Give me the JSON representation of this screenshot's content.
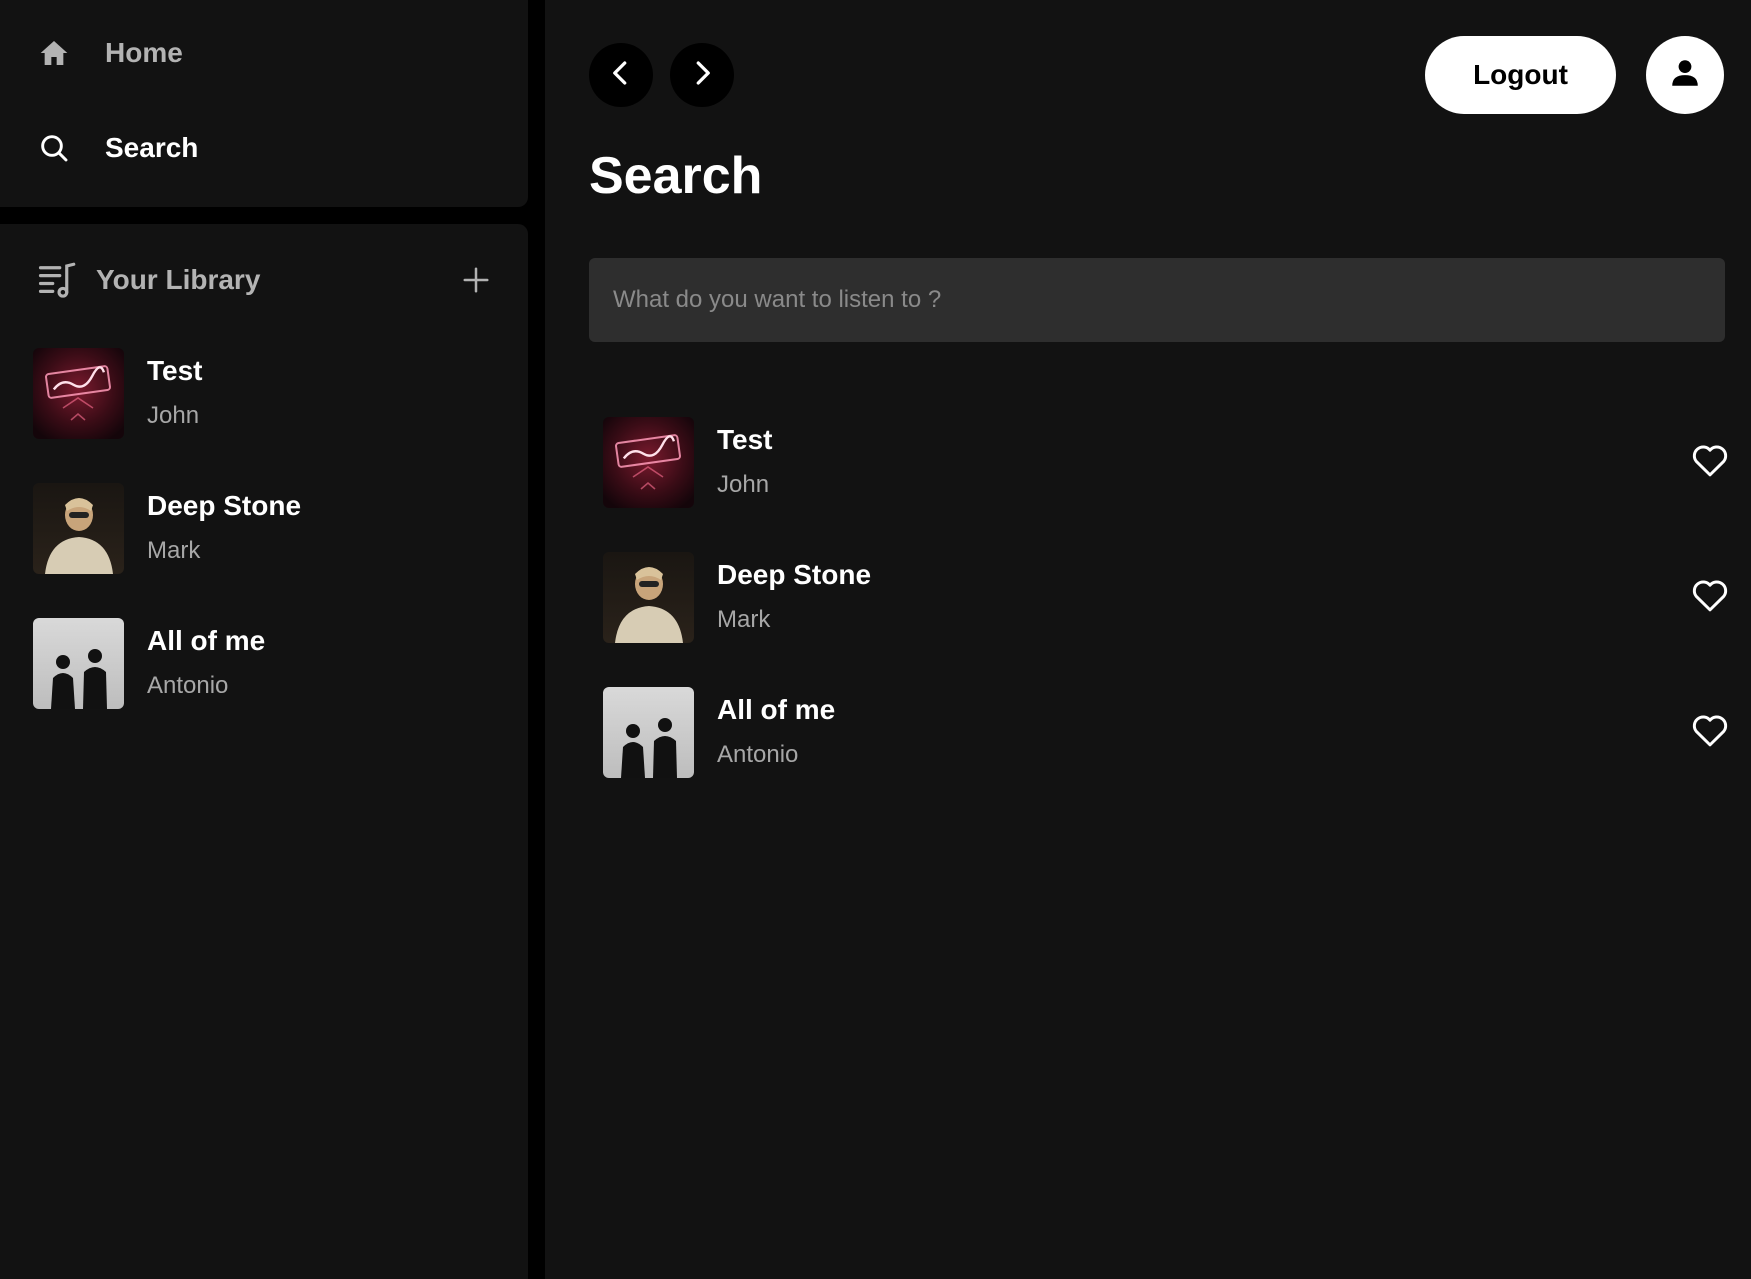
{
  "sidebar": {
    "nav": [
      {
        "label": "Home",
        "icon": "home-icon"
      },
      {
        "label": "Search",
        "icon": "search-icon"
      }
    ],
    "library": {
      "title": "Your Library",
      "icon": "library-icon",
      "add_icon": "plus-icon",
      "items": [
        {
          "title": "Test",
          "artist": "John",
          "cover": "neon-sign-cover"
        },
        {
          "title": "Deep Stone",
          "artist": "Mark",
          "cover": "portrait-cover"
        },
        {
          "title": "All of me",
          "artist": "Antonio",
          "cover": "duo-cover"
        }
      ]
    }
  },
  "header": {
    "back_icon": "chevron-left-icon",
    "forward_icon": "chevron-right-icon",
    "logout_label": "Logout",
    "avatar_icon": "user-icon"
  },
  "main": {
    "title": "Search",
    "search": {
      "placeholder": "What do you want to listen to ?",
      "value": ""
    },
    "results": [
      {
        "title": "Test",
        "artist": "John",
        "cover": "neon-sign-cover",
        "liked": false
      },
      {
        "title": "Deep Stone",
        "artist": "Mark",
        "cover": "portrait-cover",
        "liked": false
      },
      {
        "title": "All of me",
        "artist": "Antonio",
        "cover": "duo-cover",
        "liked": false
      }
    ]
  },
  "colors": {
    "background": "#000000",
    "panel": "#121212",
    "text_primary": "#ffffff",
    "text_secondary": "#a7a7a7",
    "input_bg": "#2e2e2e"
  }
}
